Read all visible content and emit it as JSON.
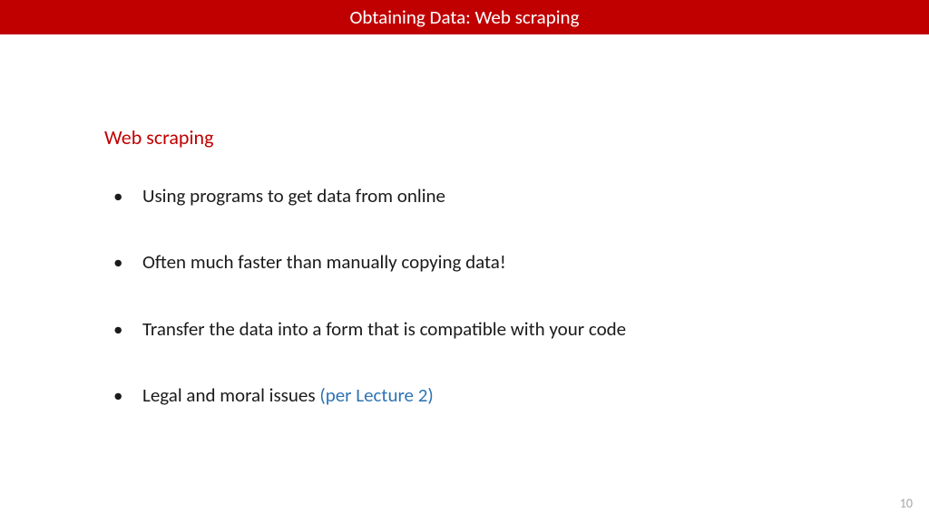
{
  "header": {
    "title": "Obtaining Data: Web scraping"
  },
  "content": {
    "heading": "Web scraping",
    "bullets": [
      {
        "text": "Using programs to get data from online",
        "link": ""
      },
      {
        "text": "Often much faster than manually copying data!",
        "link": ""
      },
      {
        "text": "Transfer the data into a form that is compatible with your code",
        "link": ""
      },
      {
        "text": "Legal and moral issues ",
        "link": "(per Lecture 2)"
      }
    ]
  },
  "footer": {
    "page_number": "10"
  }
}
